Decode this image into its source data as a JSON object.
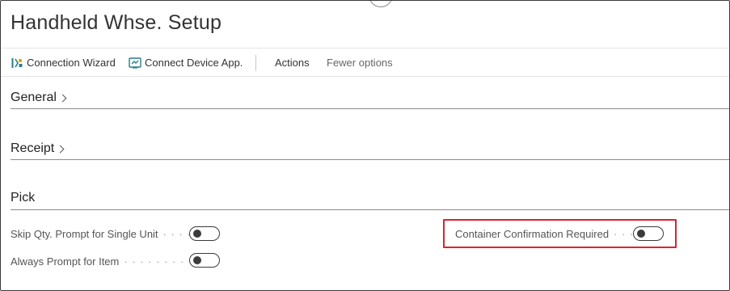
{
  "page": {
    "title": "Handheld Whse. Setup"
  },
  "actionbar": {
    "connection_wizard": "Connection Wizard",
    "connect_device_app": "Connect Device App.",
    "actions": "Actions",
    "fewer_options": "Fewer options"
  },
  "sections": {
    "general": "General",
    "receipt": "Receipt",
    "pick": "Pick"
  },
  "pick_fields": {
    "skip_qty_label": "Skip Qty. Prompt for Single Unit",
    "skip_qty_dots": "· · · ·",
    "skip_qty_value": false,
    "always_prompt_label": "Always Prompt for Item",
    "always_prompt_dots": "· · · · · · · · · · · ·",
    "always_prompt_value": false,
    "container_confirmation_label": "Container Confirmation Required",
    "container_confirmation_dots": "· · ·",
    "container_confirmation_value": false
  },
  "colors": {
    "highlight": "#d7262c",
    "icon_teal": "#2a7d8c",
    "icon_orange": "#e0a21a"
  }
}
